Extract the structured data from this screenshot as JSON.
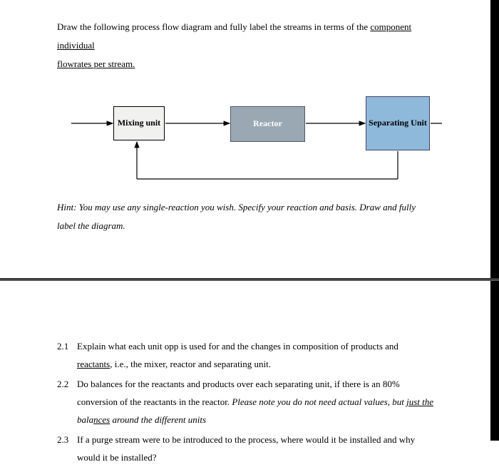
{
  "intro": {
    "prefix": "Draw the following process flow diagram and fully label the streams in terms of the ",
    "underlined1": "component individual",
    "underlined2": "flowrates per stream."
  },
  "diagram": {
    "mixing_label": "Mixing unit",
    "reactor_label": "Reactor",
    "separating_label": "Separating Unit"
  },
  "hint": {
    "text": "Hint: You may use any single-reaction you wish. Specify your reaction and basis. Draw and fully label the diagram."
  },
  "questions": {
    "q1": {
      "num": "2.1",
      "body_a": "Explain what each unit opp is used for and the changes in composition of products and ",
      "underlined": "reactants",
      "body_b": ", i.e., the mixer, reactor and separating unit."
    },
    "q2": {
      "num": "2.2",
      "body_a": "Do balances for the reactants and products over each separating unit, if there is an 80% conversion of the reactants in the reactor. ",
      "italic_a": "Please note you do not need actual values, but ",
      "italic_underlined": "just the",
      "italic_b": " bala",
      "italic_underlined2": "nces",
      "italic_c": " around the different units"
    },
    "q3": {
      "num": "2.3",
      "body": "If a purge stream were to be introduced to the process, where would it be installed and why would it be installed?"
    }
  }
}
